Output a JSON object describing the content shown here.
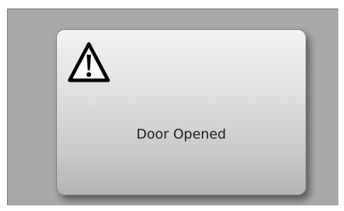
{
  "header": {
    "partial_text": "..."
  },
  "dialog": {
    "icon": "warning-triangle-icon",
    "message": "Door Opened"
  }
}
